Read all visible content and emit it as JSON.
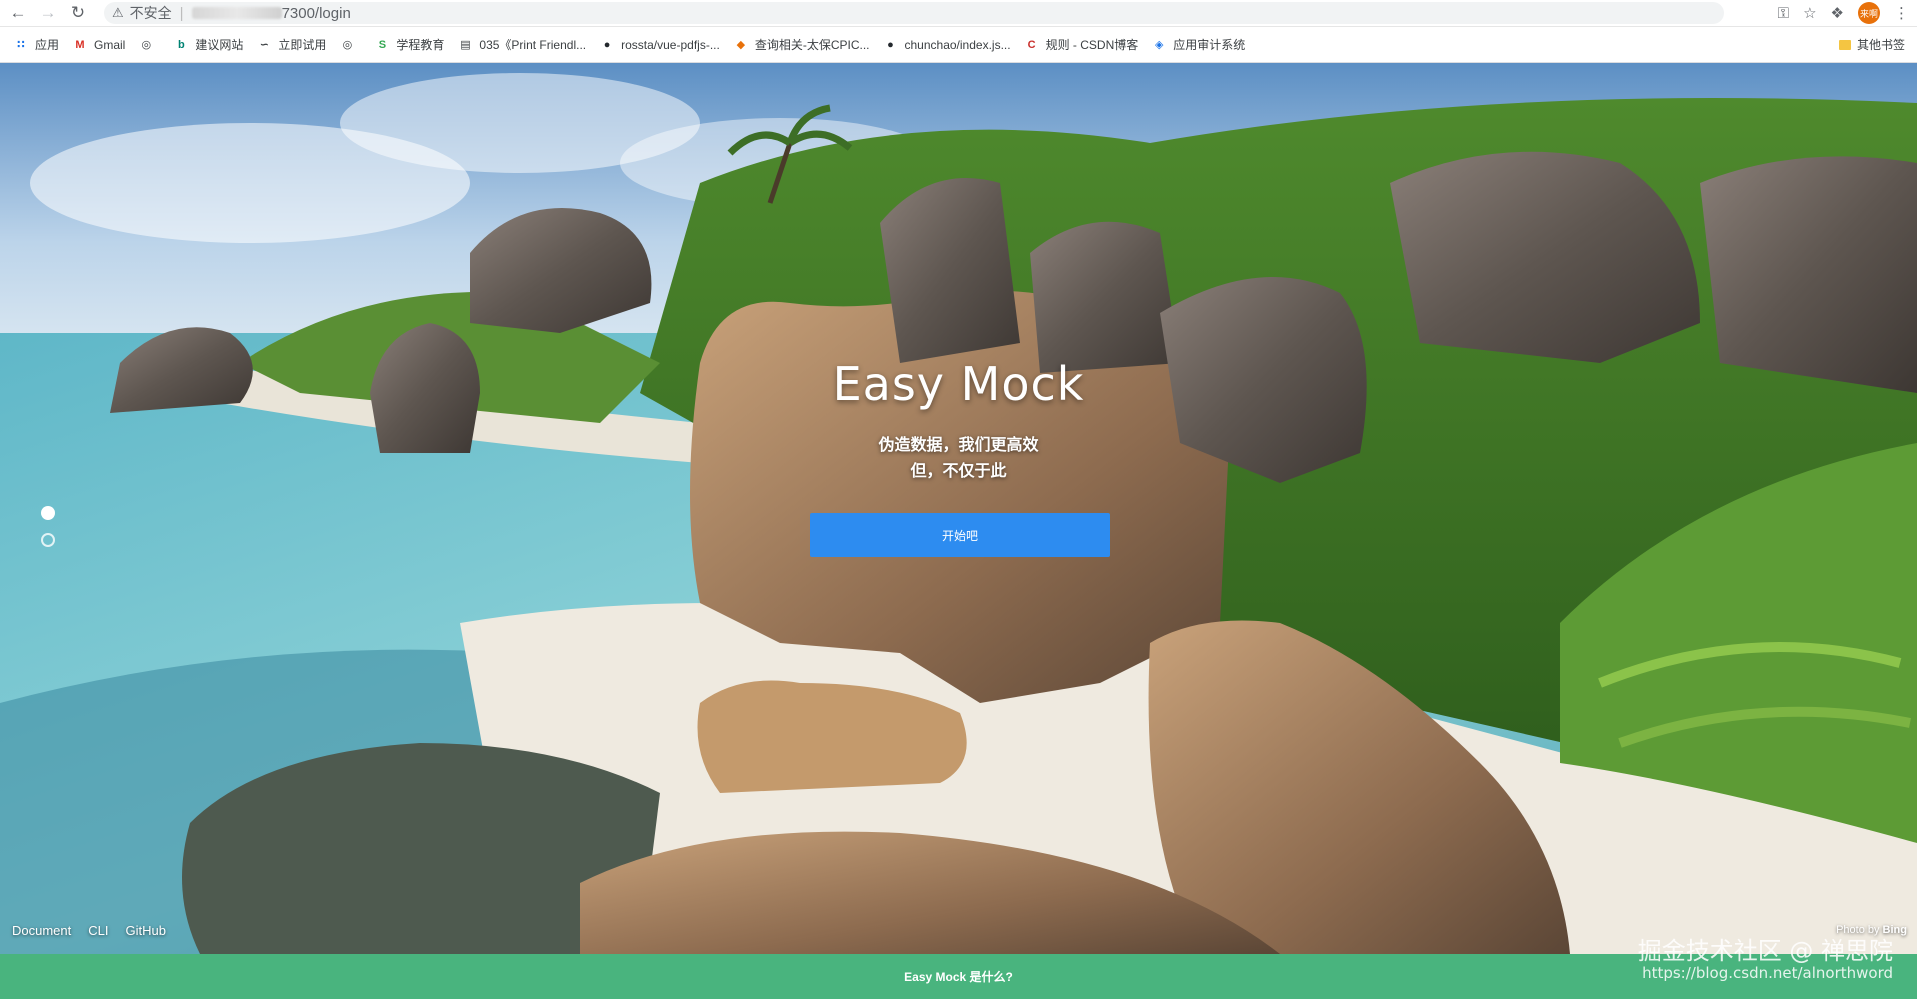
{
  "browser": {
    "security_label": "不安全",
    "url_suffix": "7300/login",
    "avatar_text": "来啊",
    "bookmarks": [
      {
        "label": "应用",
        "icon": "apps-grid-icon",
        "color": "#1a73e8"
      },
      {
        "label": "Gmail",
        "icon": "gmail-icon",
        "color": "#d93025"
      },
      {
        "label": "",
        "icon": "globe-icon",
        "color": "#3c4043"
      },
      {
        "label": "建议网站",
        "icon": "bing-icon",
        "color": "#008373"
      },
      {
        "label": "立即试用",
        "icon": "swirl-icon",
        "color": "#3c4043"
      },
      {
        "label": "",
        "icon": "globe-icon",
        "color": "#3c4043"
      },
      {
        "label": "学程教育",
        "icon": "green-s-icon",
        "color": "#34a853"
      },
      {
        "label": "035《Print Friendl...",
        "icon": "book-icon",
        "color": "#3c4043"
      },
      {
        "label": "rossta/vue-pdfjs-...",
        "icon": "github-icon",
        "color": "#24292e"
      },
      {
        "label": "查询相关-太保CPIC...",
        "icon": "fox-icon",
        "color": "#e8710a"
      },
      {
        "label": "chunchao/index.js...",
        "icon": "github-icon",
        "color": "#24292e"
      },
      {
        "label": "规则 - CSDN博客",
        "icon": "csdn-icon",
        "color": "#c9302c"
      },
      {
        "label": "应用审计系统",
        "icon": "diamond-icon",
        "color": "#1a73e8"
      }
    ],
    "other_bookmarks": "其他书签"
  },
  "hero": {
    "title": "Easy Mock",
    "subtitle_line1": "伪造数据，我们更高效",
    "subtitle_line2": "但，不仅于此",
    "start_button": "开始吧"
  },
  "footer": {
    "links": [
      "Document",
      "CLI",
      "GitHub"
    ],
    "credit_prefix": "Photo by ",
    "credit_source": "Bing"
  },
  "info_bar": {
    "text": "Easy Mock 是什么?"
  },
  "watermark": {
    "line1": "掘金技术社区 @ 禅思院",
    "line2": "https://blog.csdn.net/alnorthword"
  }
}
